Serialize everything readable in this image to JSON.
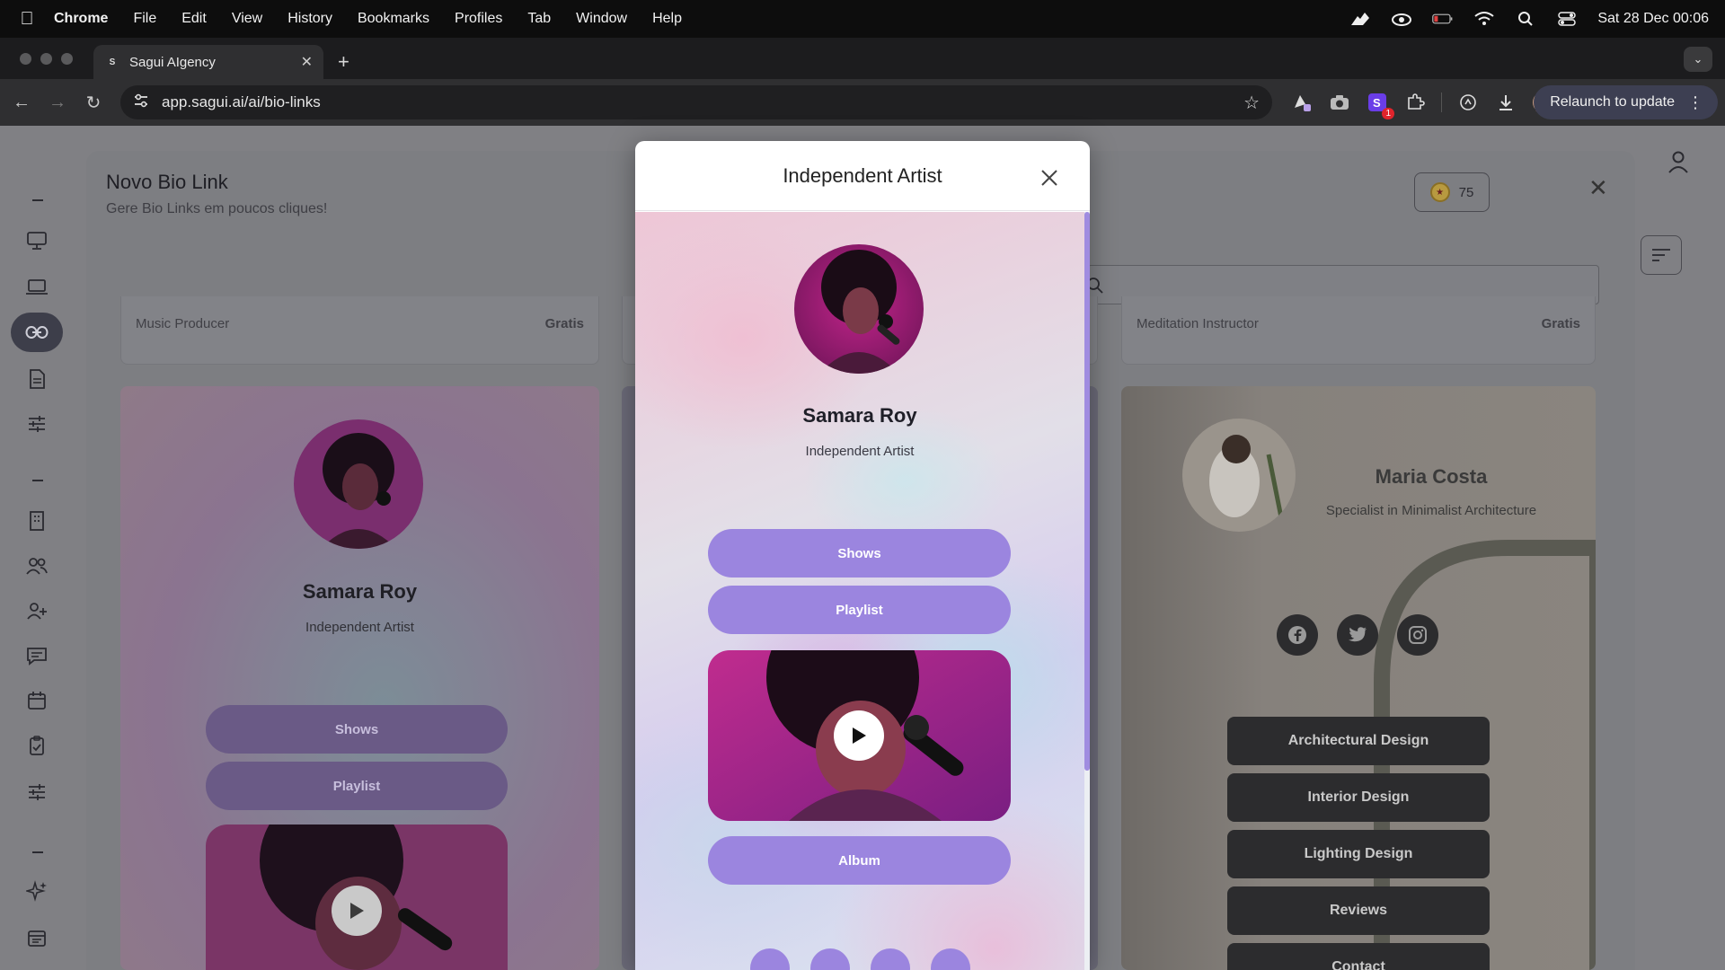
{
  "menubar": {
    "app": "Chrome",
    "items": [
      "File",
      "Edit",
      "View",
      "History",
      "Bookmarks",
      "Profiles",
      "Tab",
      "Window",
      "Help"
    ],
    "clock": "Sat 28 Dec  00:06"
  },
  "browser": {
    "tab_title": "Sagui AIgency",
    "tab_favicon": "S",
    "url": "app.sagui.ai/ai/bio-links",
    "relaunch_label": "Relaunch to update",
    "extension_badge": "1"
  },
  "page": {
    "title": "Novo Bio Link",
    "subtitle": "Gere Bio Links em poucos cliques!",
    "credits": "75",
    "strips": [
      {
        "label": "Music Producer",
        "price": "Gratis"
      },
      {
        "label": "Meditation Instructor",
        "price": "Gratis"
      }
    ],
    "left_card": {
      "name": "Samara Roy",
      "subtitle": "Independent Artist",
      "buttons": [
        "Shows",
        "Playlist"
      ]
    },
    "right_card": {
      "name": "Maria Costa",
      "subtitle": "Specialist in Minimalist Architecture",
      "social_icons": [
        "facebook-icon",
        "twitter-icon",
        "instagram-icon"
      ],
      "buttons": [
        "Architectural Design",
        "Interior Design",
        "Lighting Design",
        "Reviews",
        "Contact"
      ]
    }
  },
  "modal": {
    "title": "Independent Artist",
    "preview": {
      "name": "Samara Roy",
      "subtitle": "Independent Artist",
      "buttons": [
        "Shows",
        "Playlist"
      ],
      "album_button": "Album"
    }
  },
  "colors": {
    "accent_purple": "#9b85df",
    "dark_button": "#2c2c2e"
  }
}
